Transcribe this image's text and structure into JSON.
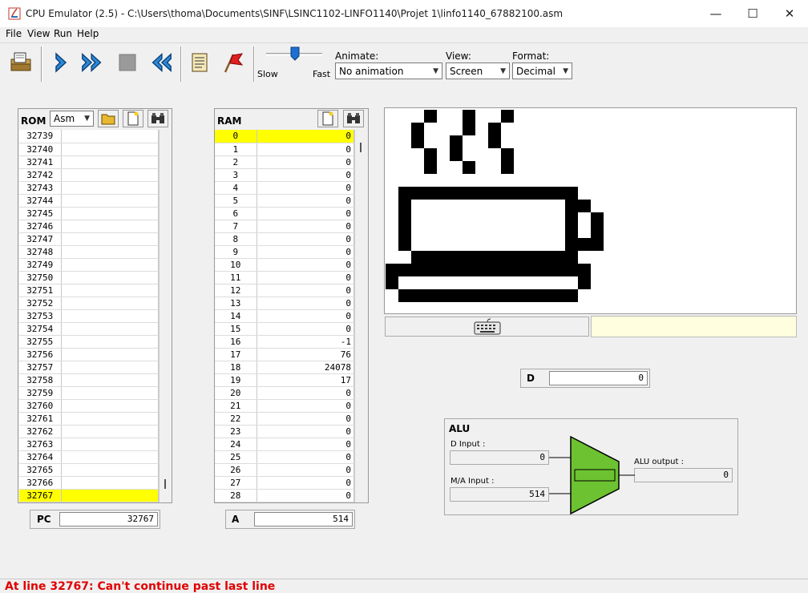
{
  "window": {
    "title": "CPU Emulator (2.5) - C:\\Users\\thoma\\Documents\\SINF\\LSINC1102-LINFO1140\\Projet 1\\linfo1140_67882100.asm"
  },
  "menu": [
    "File",
    "View",
    "Run",
    "Help"
  ],
  "toolbar": {
    "speed_slow": "Slow",
    "speed_fast": "Fast",
    "speed_level": 0.4,
    "animate_label": "Animate:",
    "animate_value": "No animation",
    "view_label": "View:",
    "view_value": "Screen",
    "format_label": "Format:",
    "format_value": "Decimal"
  },
  "rom": {
    "title": "ROM",
    "mode": "Asm",
    "rows": [
      {
        "addr": "32739",
        "instr": ""
      },
      {
        "addr": "32740",
        "instr": ""
      },
      {
        "addr": "32741",
        "instr": ""
      },
      {
        "addr": "32742",
        "instr": ""
      },
      {
        "addr": "32743",
        "instr": ""
      },
      {
        "addr": "32744",
        "instr": ""
      },
      {
        "addr": "32745",
        "instr": ""
      },
      {
        "addr": "32746",
        "instr": ""
      },
      {
        "addr": "32747",
        "instr": ""
      },
      {
        "addr": "32748",
        "instr": ""
      },
      {
        "addr": "32749",
        "instr": ""
      },
      {
        "addr": "32750",
        "instr": ""
      },
      {
        "addr": "32751",
        "instr": ""
      },
      {
        "addr": "32752",
        "instr": ""
      },
      {
        "addr": "32753",
        "instr": ""
      },
      {
        "addr": "32754",
        "instr": ""
      },
      {
        "addr": "32755",
        "instr": ""
      },
      {
        "addr": "32756",
        "instr": ""
      },
      {
        "addr": "32757",
        "instr": ""
      },
      {
        "addr": "32758",
        "instr": ""
      },
      {
        "addr": "32759",
        "instr": ""
      },
      {
        "addr": "32760",
        "instr": ""
      },
      {
        "addr": "32761",
        "instr": ""
      },
      {
        "addr": "32762",
        "instr": ""
      },
      {
        "addr": "32763",
        "instr": ""
      },
      {
        "addr": "32764",
        "instr": ""
      },
      {
        "addr": "32765",
        "instr": ""
      },
      {
        "addr": "32766",
        "instr": ""
      },
      {
        "addr": "32767",
        "instr": ""
      }
    ],
    "highlight_index": 28
  },
  "ram": {
    "title": "RAM",
    "rows": [
      {
        "addr": "0",
        "val": "0"
      },
      {
        "addr": "1",
        "val": "0"
      },
      {
        "addr": "2",
        "val": "0"
      },
      {
        "addr": "3",
        "val": "0"
      },
      {
        "addr": "4",
        "val": "0"
      },
      {
        "addr": "5",
        "val": "0"
      },
      {
        "addr": "6",
        "val": "0"
      },
      {
        "addr": "7",
        "val": "0"
      },
      {
        "addr": "8",
        "val": "0"
      },
      {
        "addr": "9",
        "val": "0"
      },
      {
        "addr": "10",
        "val": "0"
      },
      {
        "addr": "11",
        "val": "0"
      },
      {
        "addr": "12",
        "val": "0"
      },
      {
        "addr": "13",
        "val": "0"
      },
      {
        "addr": "14",
        "val": "0"
      },
      {
        "addr": "15",
        "val": "0"
      },
      {
        "addr": "16",
        "val": "-1"
      },
      {
        "addr": "17",
        "val": "76"
      },
      {
        "addr": "18",
        "val": "24078"
      },
      {
        "addr": "19",
        "val": "17"
      },
      {
        "addr": "20",
        "val": "0"
      },
      {
        "addr": "21",
        "val": "0"
      },
      {
        "addr": "22",
        "val": "0"
      },
      {
        "addr": "23",
        "val": "0"
      },
      {
        "addr": "24",
        "val": "0"
      },
      {
        "addr": "25",
        "val": "0"
      },
      {
        "addr": "26",
        "val": "0"
      },
      {
        "addr": "27",
        "val": "0"
      },
      {
        "addr": "28",
        "val": "0"
      }
    ],
    "highlight_index": 0
  },
  "registers": {
    "pc_label": "PC",
    "pc_value": "32767",
    "a_label": "A",
    "a_value": "514",
    "d_label": "D",
    "d_value": "0"
  },
  "alu": {
    "title": "ALU",
    "d_input_label": "D Input :",
    "d_input_value": "0",
    "ma_input_label": "M/A Input :",
    "ma_input_value": "514",
    "output_label": "ALU output :",
    "output_value": "0",
    "body_color": "#6cc230"
  },
  "status": {
    "message": "At line 32767: Can't continue past last line",
    "color": "#e00000"
  },
  "colors": {
    "highlight": "#ffff00",
    "keyboard_field": "#ffffe0"
  }
}
